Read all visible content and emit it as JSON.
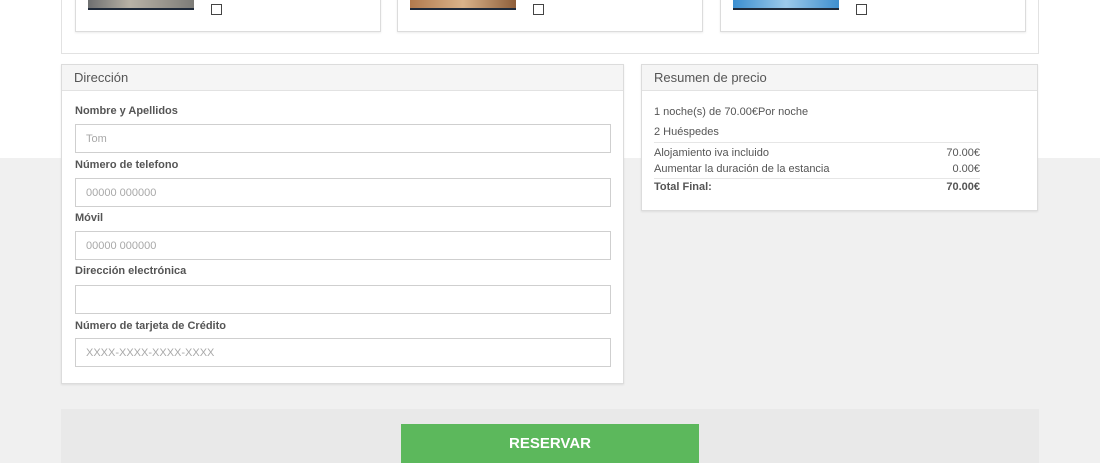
{
  "rooms": [
    {
      "thumb": "room-photo-1",
      "checked": false
    },
    {
      "thumb": "room-photo-2",
      "checked": false
    },
    {
      "thumb": "room-photo-3",
      "checked": false
    }
  ],
  "address": {
    "title": "Dirección",
    "fields": [
      {
        "label": "Nombre y Apellidos",
        "value": "",
        "placeholder": "Tom"
      },
      {
        "label": "Número de telefono",
        "value": "",
        "placeholder": "00000 000000"
      },
      {
        "label": "Móvil",
        "value": "",
        "placeholder": "00000 000000"
      },
      {
        "label": "Dirección electrónica",
        "value": "",
        "placeholder": ""
      },
      {
        "label": "Número de tarjeta de Crédito",
        "value": "",
        "placeholder": "XXXX-XXXX-XXXX-XXXX"
      }
    ]
  },
  "price": {
    "title": "Resumen de precio",
    "nights_line": "1 noche(s) de 70.00€Por noche",
    "guests_line": "2 Huéspedes",
    "rows": [
      {
        "label": "Alojamiento iva incluido",
        "value": "70.00€"
      },
      {
        "label": "Aumentar la duración de la estancia",
        "value": "0.00€"
      }
    ],
    "total": {
      "label": "Total Final:",
      "value": "70.00€"
    }
  },
  "actions": {
    "reserve_label": "RESERVAR"
  },
  "colors": {
    "accent_green": "#5cb85c",
    "page_gray": "#f0f0f0"
  }
}
